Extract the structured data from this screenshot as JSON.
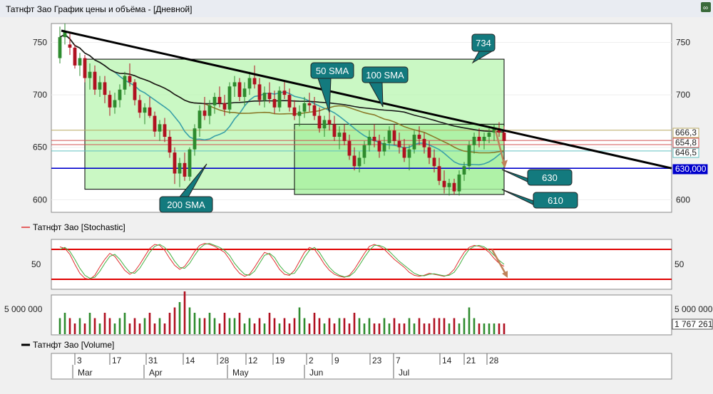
{
  "window": {
    "title": "Татнфт Зао График цены и объёма - [Дневной]",
    "corner_icon": "link-icon"
  },
  "colors": {
    "bull": "#2e8b2e",
    "bear": "#b01020",
    "sma50": "#8a7a2a",
    "sma100": "#3aa0a8",
    "sma200": "#1a1a1a",
    "trend": "#000000",
    "support": "#0000cc",
    "zone": "#b8f5b0",
    "callout": "#137a7e",
    "arrow": "#c0825a",
    "stoch_k": "#e03030",
    "stoch_d": "#40b040",
    "stoch_band": "#e00000"
  },
  "price_panel": {
    "y_ticks": [
      600,
      650,
      700,
      750
    ],
    "right_ticks": [
      600,
      650,
      700,
      750
    ],
    "ylim": [
      588,
      768
    ],
    "price_labels": [
      "666,3",
      "654,8",
      "646,5",
      "630,000"
    ],
    "callouts": {
      "c734": "734",
      "c50": "50 SMA",
      "c100": "100 SMA",
      "c200": "200 SMA",
      "c630": "630",
      "c610": "610"
    }
  },
  "stoch_panel": {
    "title": "Татнфт Зао [Stochastic]",
    "tick": "50",
    "right_tick": "50"
  },
  "volume_panel": {
    "tick": "5 000 000",
    "right_tick": "5 000 000",
    "last_volume": "1 767 261"
  },
  "legend": {
    "label": "Татнфт Зао [Volume]"
  },
  "time_axis": {
    "days": [
      "3",
      "17",
      "31",
      "14",
      "28",
      "12",
      "19",
      "2",
      "9",
      "23",
      "7",
      "14",
      "21",
      "28"
    ],
    "months": [
      "Mar",
      "Apr",
      "May",
      "Jun",
      "Jul"
    ]
  },
  "chart_data": {
    "type": "candlestick",
    "series": [
      {
        "name": "Татнфт Зао",
        "values": [
          [
            735,
            765,
            730,
            755
          ],
          [
            755,
            768,
            748,
            760
          ],
          [
            748,
            760,
            738,
            745
          ],
          [
            745,
            748,
            725,
            728
          ],
          [
            728,
            740,
            718,
            735
          ],
          [
            735,
            738,
            712,
            716
          ],
          [
            716,
            730,
            705,
            722
          ],
          [
            722,
            728,
            700,
            705
          ],
          [
            705,
            718,
            698,
            712
          ],
          [
            712,
            718,
            692,
            700
          ],
          [
            700,
            704,
            680,
            688
          ],
          [
            688,
            702,
            682,
            695
          ],
          [
            695,
            710,
            688,
            705
          ],
          [
            705,
            722,
            700,
            718
          ],
          [
            718,
            730,
            708,
            712
          ],
          [
            712,
            715,
            690,
            695
          ],
          [
            695,
            700,
            678,
            683
          ],
          [
            683,
            692,
            672,
            688
          ],
          [
            688,
            698,
            678,
            680
          ],
          [
            680,
            684,
            660,
            665
          ],
          [
            665,
            676,
            656,
            672
          ],
          [
            672,
            678,
            655,
            660
          ],
          [
            660,
            666,
            640,
            645
          ],
          [
            645,
            650,
            615,
            625
          ],
          [
            625,
            640,
            612,
            635
          ],
          [
            635,
            645,
            618,
            622
          ],
          [
            622,
            650,
            618,
            648
          ],
          [
            648,
            672,
            642,
            668
          ],
          [
            668,
            690,
            660,
            685
          ],
          [
            685,
            698,
            676,
            680
          ],
          [
            680,
            695,
            672,
            690
          ],
          [
            690,
            702,
            682,
            698
          ],
          [
            698,
            708,
            688,
            692
          ],
          [
            692,
            700,
            680,
            686
          ],
          [
            686,
            712,
            682,
            708
          ],
          [
            708,
            718,
            698,
            712
          ],
          [
            712,
            716,
            694,
            698
          ],
          [
            698,
            712,
            690,
            706
          ],
          [
            706,
            722,
            700,
            716
          ],
          [
            716,
            728,
            706,
            710
          ],
          [
            710,
            716,
            690,
            695
          ],
          [
            695,
            708,
            688,
            702
          ],
          [
            702,
            712,
            692,
            696
          ],
          [
            696,
            704,
            682,
            688
          ],
          [
            688,
            708,
            684,
            704
          ],
          [
            704,
            714,
            696,
            700
          ],
          [
            700,
            706,
            684,
            688
          ],
          [
            688,
            695,
            676,
            680
          ],
          [
            680,
            690,
            670,
            684
          ],
          [
            684,
            698,
            678,
            692
          ],
          [
            692,
            702,
            684,
            690
          ],
          [
            690,
            698,
            676,
            680
          ],
          [
            680,
            688,
            664,
            668
          ],
          [
            668,
            680,
            660,
            676
          ],
          [
            676,
            686,
            666,
            672
          ],
          [
            672,
            680,
            656,
            660
          ],
          [
            660,
            670,
            648,
            664
          ],
          [
            664,
            672,
            652,
            656
          ],
          [
            656,
            662,
            638,
            642
          ],
          [
            642,
            650,
            628,
            632
          ],
          [
            632,
            646,
            626,
            640
          ],
          [
            640,
            656,
            634,
            652
          ],
          [
            652,
            666,
            646,
            660
          ],
          [
            660,
            672,
            650,
            656
          ],
          [
            656,
            662,
            640,
            646
          ],
          [
            646,
            660,
            642,
            654
          ],
          [
            654,
            670,
            648,
            666
          ],
          [
            666,
            672,
            652,
            656
          ],
          [
            656,
            664,
            644,
            650
          ],
          [
            650,
            658,
            636,
            640
          ],
          [
            640,
            652,
            628,
            648
          ],
          [
            648,
            666,
            644,
            662
          ],
          [
            662,
            670,
            652,
            658
          ],
          [
            658,
            664,
            644,
            650
          ],
          [
            650,
            656,
            634,
            640
          ],
          [
            640,
            648,
            626,
            632
          ],
          [
            632,
            640,
            614,
            618
          ],
          [
            618,
            628,
            606,
            612
          ],
          [
            612,
            620,
            604,
            616
          ],
          [
            616,
            620,
            605,
            608
          ],
          [
            608,
            628,
            604,
            624
          ],
          [
            624,
            636,
            618,
            632
          ],
          [
            632,
            656,
            628,
            652
          ],
          [
            652,
            664,
            644,
            660
          ],
          [
            660,
            668,
            650,
            656
          ],
          [
            656,
            664,
            648,
            660
          ],
          [
            660,
            668,
            654,
            664
          ],
          [
            664,
            672,
            656,
            668
          ],
          [
            668,
            674,
            660,
            664
          ],
          [
            664,
            670,
            652,
            656
          ]
        ]
      },
      {
        "name": "50 SMA"
      },
      {
        "name": "100 SMA"
      },
      {
        "name": "200 SMA"
      }
    ],
    "stochastic": {
      "name": "Татнфт Зао [Stochastic]",
      "k": [
        85,
        82,
        70,
        50,
        32,
        22,
        20,
        28,
        45,
        60,
        72,
        66,
        52,
        38,
        30,
        36,
        50,
        66,
        82,
        90,
        88,
        78,
        62,
        48,
        40,
        46,
        60,
        76,
        88,
        92,
        90,
        86,
        80,
        74,
        60,
        44,
        32,
        26,
        30,
        44,
        60,
        74,
        70,
        56,
        40,
        30,
        28,
        38,
        56,
        74,
        84,
        80,
        66,
        50,
        38,
        30,
        26,
        24,
        28,
        40,
        56,
        72,
        86,
        90,
        86,
        80,
        70,
        60,
        52,
        44,
        34,
        28,
        26,
        28,
        32,
        30,
        28,
        26,
        30,
        40,
        58,
        74,
        84,
        88,
        86,
        82,
        74,
        62,
        52,
        46
      ],
      "d": [
        80,
        84,
        76,
        60,
        42,
        28,
        22,
        24,
        36,
        52,
        66,
        70,
        60,
        46,
        34,
        32,
        42,
        58,
        74,
        86,
        90,
        84,
        72,
        56,
        44,
        42,
        52,
        68,
        82,
        90,
        92,
        88,
        84,
        78,
        68,
        52,
        40,
        30,
        28,
        36,
        52,
        68,
        72,
        64,
        48,
        36,
        30,
        32,
        46,
        64,
        78,
        84,
        74,
        58,
        44,
        34,
        28,
        25,
        26,
        34,
        48,
        64,
        78,
        88,
        88,
        84,
        76,
        66,
        56,
        48,
        40,
        32,
        28,
        27,
        30,
        31,
        29,
        27,
        28,
        34,
        48,
        66,
        80,
        86,
        88,
        85,
        78,
        68,
        58,
        50
      ]
    },
    "volume": [
      3,
      4,
      3,
      2,
      3,
      2,
      4,
      3,
      2,
      4,
      3,
      2,
      3,
      4,
      2,
      3,
      2,
      3,
      4,
      2,
      3,
      2,
      4,
      5,
      6,
      8,
      5,
      4,
      3,
      3,
      4,
      3,
      2,
      4,
      3,
      3,
      4,
      2,
      3,
      2,
      3,
      2,
      4,
      3,
      2,
      3,
      2,
      3,
      5,
      3,
      2,
      4,
      3,
      2,
      3,
      2,
      3,
      3,
      2,
      4,
      3,
      2,
      3,
      2,
      2,
      3,
      2,
      3,
      2,
      2,
      3,
      2,
      3,
      2,
      2,
      3,
      3,
      3,
      2,
      3,
      2,
      3,
      5,
      3,
      2,
      2,
      2,
      2,
      2,
      2
    ],
    "volume_units": "millions",
    "support_level": 630,
    "resistance_zone": [
      610,
      734
    ]
  }
}
